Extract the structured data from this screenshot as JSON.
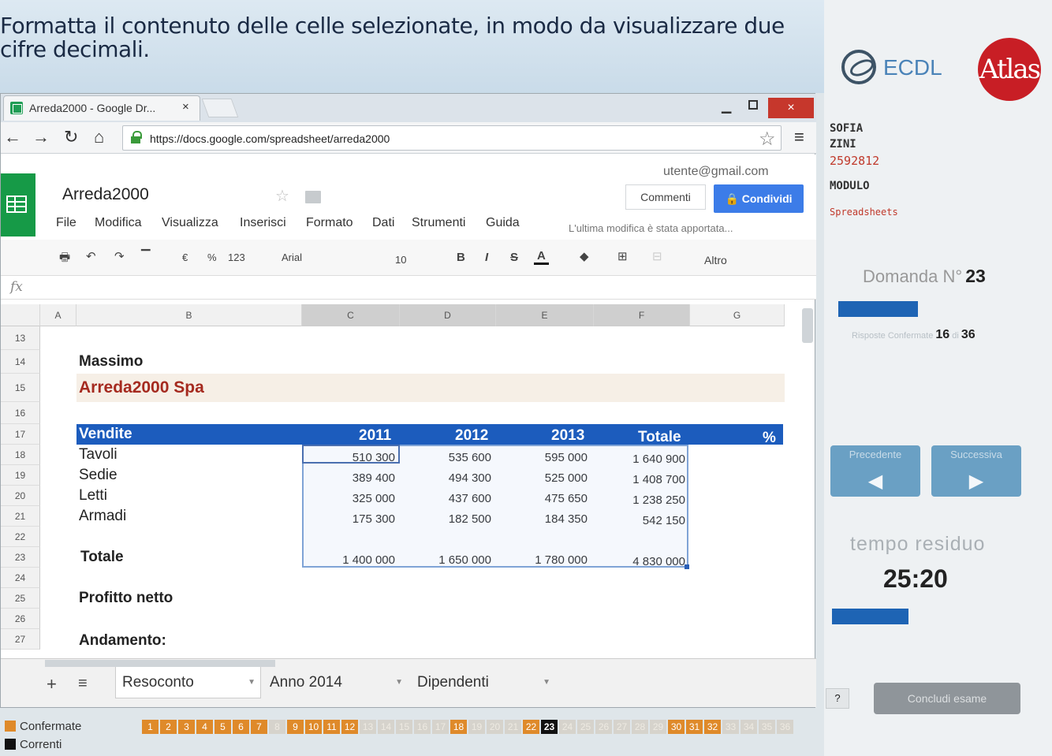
{
  "question": {
    "text": "Formatta il contenuto delle celle selezionate, in modo da visualizzare due cifre decimali."
  },
  "panel": {
    "ecdl": "ECDL",
    "atlas_logo": "Atlas",
    "first_name": "SOFIA",
    "last_name": "ZINI",
    "candidate_id": "2592812",
    "module_label": "MODULO",
    "module_value": "Spreadsheets",
    "domanda_label": "Domanda N°",
    "domanda_number": "23",
    "progress_fraction": 0.44,
    "risposte_label": "Risposte Confermate",
    "risposte_count": "16",
    "risposte_of": "di",
    "risposte_total": "36",
    "prev_label": "Precedente",
    "next_label": "Successiva",
    "tempo_label": "tempo residuo",
    "tempo_value": "25:20",
    "help_label": "?",
    "conclude_label": "Concludi esame"
  },
  "browser": {
    "tab_title": "Arreda2000 - Google Dr...",
    "tab_close": "×",
    "url": "https://docs.google.com/spreadsheet/arreda2000",
    "win_close": "×"
  },
  "sheets": {
    "title": "Arreda2000",
    "user_email": "utente@gmail.com",
    "comments": "Commenti",
    "share": "Condividi",
    "menu": [
      "File",
      "Modifica",
      "Visualizza",
      "Inserisci",
      "Formato",
      "Dati",
      "Strumenti",
      "Guida"
    ],
    "last_edit": "L'ultima modifica è stata apportata...",
    "toolbar": {
      "euro": "€",
      "percent": "%",
      "number_format": "123",
      "font": "Arial",
      "size": "10",
      "bold": "B",
      "italic": "I",
      "strike": "S",
      "text_color": "A",
      "altro": "Altro"
    },
    "fx": "fx"
  },
  "grid": {
    "columns": [
      "A",
      "B",
      "C",
      "D",
      "E",
      "F",
      "G"
    ],
    "rows": [
      "13",
      "14",
      "15",
      "16",
      "17",
      "18",
      "19",
      "20",
      "21",
      "22",
      "23",
      "24",
      "25",
      "26",
      "27"
    ],
    "b14": "Massimo",
    "b15": "Arreda2000 Spa",
    "header": {
      "label": "Vendite",
      "y2011": "2011",
      "y2012": "2012",
      "y2013": "2013",
      "total": "Totale",
      "pct": "%"
    },
    "data": [
      {
        "label": "Tavoli",
        "c": "510 300",
        "d": "535 600",
        "e": "595 000",
        "f": "1 640 900"
      },
      {
        "label": "Sedie",
        "c": "389 400",
        "d": "494 300",
        "e": "525 000",
        "f": "1 408 700"
      },
      {
        "label": "Letti",
        "c": "325 000",
        "d": "437 600",
        "e": "475 650",
        "f": "1 238 250"
      },
      {
        "label": "Armadi",
        "c": "175 300",
        "d": "182 500",
        "e": "184 350",
        "f": "542 150"
      }
    ],
    "total": {
      "label": "Totale",
      "c": "1 400 000",
      "d": "1 650 000",
      "e": "1 780 000",
      "f": "4 830 000"
    },
    "b25": "Profitto netto",
    "b27": "Andamento:"
  },
  "sheet_tabs": [
    "Resoconto",
    "Anno 2014",
    "Dipendenti"
  ],
  "legend": {
    "confirmed": "Confermate",
    "current": "Correnti"
  },
  "questions": [
    {
      "n": "1",
      "s": "c"
    },
    {
      "n": "2",
      "s": "c"
    },
    {
      "n": "3",
      "s": "c"
    },
    {
      "n": "4",
      "s": "c"
    },
    {
      "n": "5",
      "s": "c"
    },
    {
      "n": "6",
      "s": "c"
    },
    {
      "n": "7",
      "s": "c"
    },
    {
      "n": "8",
      "s": "n"
    },
    {
      "n": "9",
      "s": "c"
    },
    {
      "n": "10",
      "s": "c"
    },
    {
      "n": "11",
      "s": "c"
    },
    {
      "n": "12",
      "s": "c"
    },
    {
      "n": "13",
      "s": "n"
    },
    {
      "n": "14",
      "s": "n"
    },
    {
      "n": "15",
      "s": "n"
    },
    {
      "n": "16",
      "s": "n"
    },
    {
      "n": "17",
      "s": "n"
    },
    {
      "n": "18",
      "s": "c"
    },
    {
      "n": "19",
      "s": "n"
    },
    {
      "n": "20",
      "s": "n"
    },
    {
      "n": "21",
      "s": "n"
    },
    {
      "n": "22",
      "s": "c"
    },
    {
      "n": "23",
      "s": "cur"
    },
    {
      "n": "24",
      "s": "n"
    },
    {
      "n": "25",
      "s": "n"
    },
    {
      "n": "26",
      "s": "n"
    },
    {
      "n": "27",
      "s": "n"
    },
    {
      "n": "28",
      "s": "n"
    },
    {
      "n": "29",
      "s": "n"
    },
    {
      "n": "30",
      "s": "c"
    },
    {
      "n": "31",
      "s": "c"
    },
    {
      "n": "32",
      "s": "c"
    },
    {
      "n": "33",
      "s": "n"
    },
    {
      "n": "34",
      "s": "n"
    },
    {
      "n": "35",
      "s": "n"
    },
    {
      "n": "36",
      "s": "n"
    }
  ],
  "colors": {
    "confirmed": "#df8a2a",
    "current": "#111111",
    "header_band": "#1c5cbd",
    "accent_red": "#c81e25"
  }
}
